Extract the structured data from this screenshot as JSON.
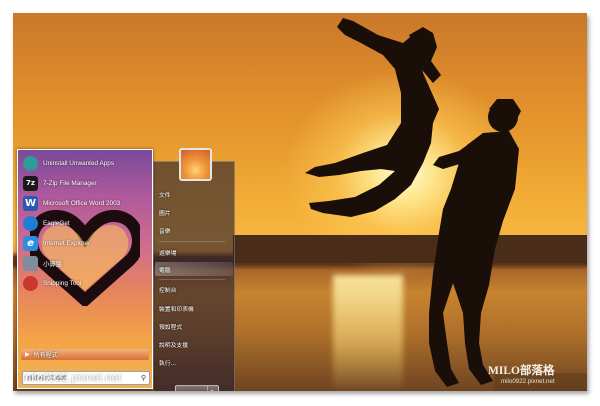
{
  "start_menu": {
    "programs": [
      {
        "label": "Uninstall Unwanted Apps",
        "icon": "uninstall-icon",
        "color": "#2f9a9a"
      },
      {
        "label": "7-Zip File Manager",
        "icon": "seven-zip-icon",
        "color": "#1a1a1a",
        "glyph": "7z"
      },
      {
        "label": "Microsoft Office Word 2003",
        "icon": "word-icon",
        "color": "#2b58b5",
        "glyph": "W"
      },
      {
        "label": "EagleGet",
        "icon": "eagleget-icon",
        "color": "#1f7dd6"
      },
      {
        "label": "Internet Explorer",
        "icon": "internet-explorer-icon",
        "color": "#2d8ee0",
        "glyph": "e"
      },
      {
        "label": "小算盤",
        "icon": "calculator-icon",
        "color": "#7f8c9a"
      },
      {
        "label": "Snipping Tool",
        "icon": "snipping-tool-icon",
        "color": "#c8382f"
      }
    ],
    "all_programs": "所有程式",
    "search_placeholder": "搜尋程式及檔案",
    "right_items": [
      {
        "label": "文件"
      },
      {
        "label": "圖片"
      },
      {
        "label": "音樂"
      },
      {
        "label": "遊樂場"
      },
      {
        "label": "電腦"
      },
      {
        "label": "控制台"
      },
      {
        "label": "裝置和印表機"
      },
      {
        "label": "預設程式"
      },
      {
        "label": "說明及支援"
      },
      {
        "label": "執行..."
      }
    ]
  },
  "watermark": {
    "url": "milo0922.pixnet.net",
    "brand": "MILO部落格",
    "brand_url": "milo0922.pixnet.net"
  },
  "colors": {
    "sky": "#e79a2e",
    "sun": "#fff3b0",
    "silhouette": "#1a0e08"
  }
}
